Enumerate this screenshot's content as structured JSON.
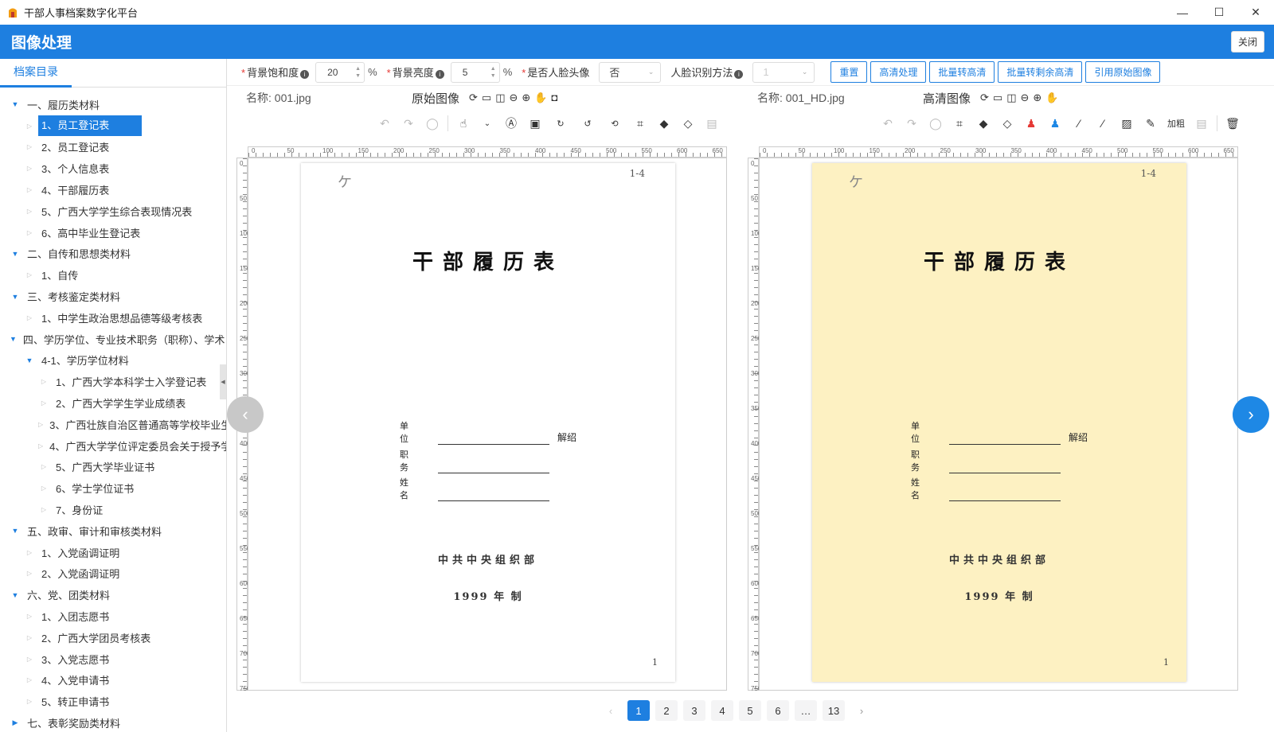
{
  "window": {
    "title": "干部人事档案数字化平台",
    "minimize": "—",
    "maximize": "☐",
    "close": "✕"
  },
  "header": {
    "title": "图像处理",
    "close_label": "关闭"
  },
  "sidebar": {
    "tab": "档案目录",
    "tree": [
      {
        "label": "一、履历类材料",
        "level": 0,
        "expanded": true
      },
      {
        "label": "1、员工登记表",
        "level": 1,
        "selected": true
      },
      {
        "label": "2、员工登记表",
        "level": 1
      },
      {
        "label": "3、个人信息表",
        "level": 1
      },
      {
        "label": "4、干部履历表",
        "level": 1
      },
      {
        "label": "5、广西大学学生综合表现情况表",
        "level": 1
      },
      {
        "label": "6、高中毕业生登记表",
        "level": 1
      },
      {
        "label": "二、自传和思想类材料",
        "level": 0,
        "expanded": true
      },
      {
        "label": "1、自传",
        "level": 1
      },
      {
        "label": "三、考核鉴定类材料",
        "level": 0,
        "expanded": true
      },
      {
        "label": "1、中学生政治思想品德等级考核表",
        "level": 1
      },
      {
        "label": "四、学历学位、专业技术职务（职称）、学术",
        "level": 0,
        "expanded": true
      },
      {
        "label": "4-1、学历学位材料",
        "level": 1,
        "expanded": true
      },
      {
        "label": "1、广西大学本科学士入学登记表",
        "level": 2
      },
      {
        "label": "2、广西大学学生学业成绩表",
        "level": 2
      },
      {
        "label": "3、广西壮族自治区普通高等学校毕业生",
        "level": 2
      },
      {
        "label": "4、广西大学学位评定委员会关于授予学",
        "level": 2
      },
      {
        "label": "5、广西大学毕业证书",
        "level": 2
      },
      {
        "label": "6、学士学位证书",
        "level": 2
      },
      {
        "label": "7、身份证",
        "level": 2
      },
      {
        "label": "五、政审、审计和审核类材料",
        "level": 0,
        "expanded": true
      },
      {
        "label": "1、入党函调证明",
        "level": 1
      },
      {
        "label": "2、入党函调证明",
        "level": 1
      },
      {
        "label": "六、党、团类材料",
        "level": 0,
        "expanded": true
      },
      {
        "label": "1、入团志愿书",
        "level": 1
      },
      {
        "label": "2、广西大学团员考核表",
        "level": 1
      },
      {
        "label": "3、入党志愿书",
        "level": 1
      },
      {
        "label": "4、入党申请书",
        "level": 1
      },
      {
        "label": "5、转正申请书",
        "level": 1
      },
      {
        "label": "七、表彰奖励类材料",
        "level": 0,
        "expanded": false
      }
    ]
  },
  "toolbar": {
    "saturation_label": "背景饱和度",
    "saturation_value": "20",
    "brightness_label": "背景亮度",
    "brightness_value": "5",
    "percent": "%",
    "face_label": "是否人脸头像",
    "face_value": "否",
    "face_method_label": "人脸识别方法",
    "face_method_value": "1",
    "buttons": [
      "重置",
      "高清处理",
      "批量转高清",
      "批量转剩余高清",
      "引用原始图像"
    ]
  },
  "left_pane": {
    "name_label": "名称:",
    "file_name": "001.jpg",
    "title": "原始图像"
  },
  "right_pane": {
    "name_label": "名称:",
    "file_name": "001_HD.jpg",
    "title": "高清图像",
    "bold_tool": "加粗"
  },
  "document": {
    "mark_tl": "ケ",
    "mark_tr": "1-4",
    "title": "干部履历表",
    "unit_label": "单位",
    "unit_tail": "解绍",
    "post_label": "职务",
    "name_label": "姓名",
    "org": "中共中央组织部",
    "year": "1999 年  制",
    "mark_br": "1"
  },
  "ruler": {
    "h_ticks": [
      "0",
      "50",
      "100",
      "150",
      "200",
      "250",
      "300",
      "350",
      "400",
      "450",
      "500",
      "550",
      "600",
      "650"
    ],
    "v_ticks": [
      "0",
      "50",
      "100",
      "150",
      "200",
      "250",
      "300",
      "350",
      "400",
      "450",
      "500",
      "550",
      "600",
      "650",
      "700",
      "750"
    ]
  },
  "pagination": {
    "pages": [
      "1",
      "2",
      "3",
      "4",
      "5",
      "6",
      "…",
      "13"
    ],
    "current": "1",
    "prev": "‹",
    "next": "›"
  },
  "colors": {
    "primary": "#1e7fe0",
    "hd_paper": "#fdf1c2"
  }
}
